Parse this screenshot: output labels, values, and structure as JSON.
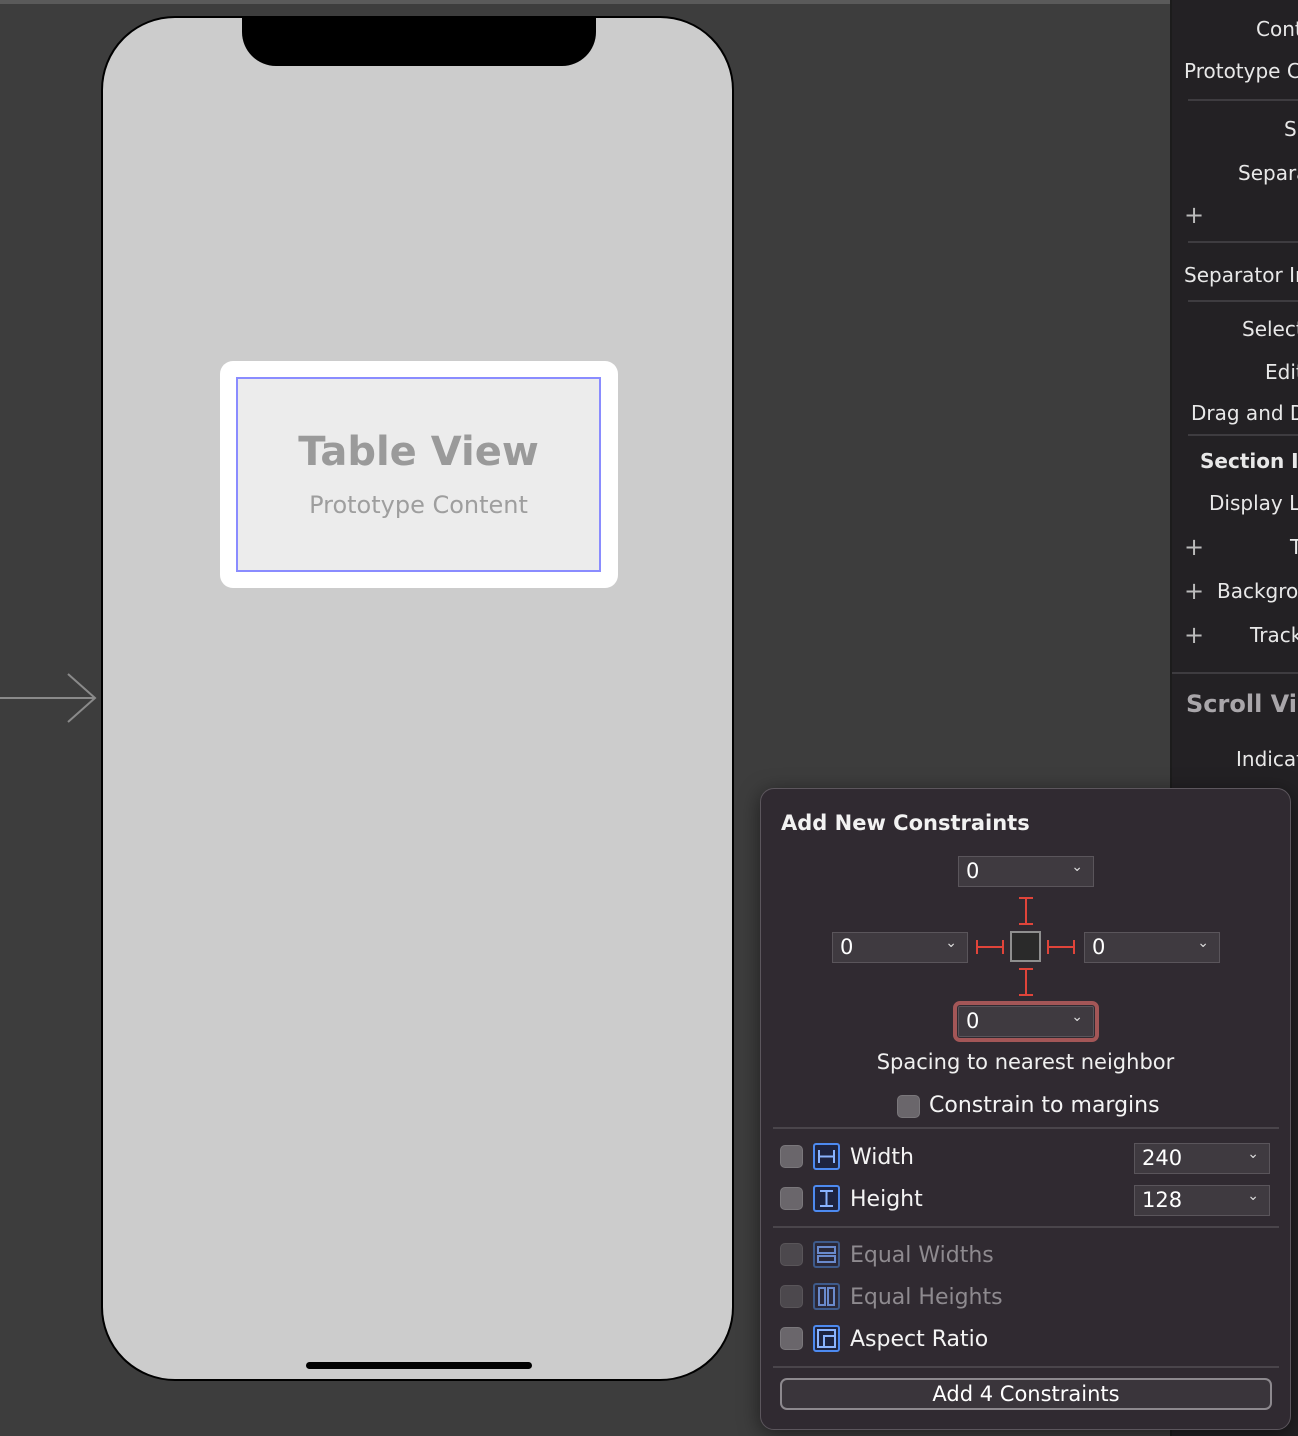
{
  "canvas": {
    "table_view": {
      "title": "Table View",
      "subtitle": "Prototype Content"
    }
  },
  "inspector": {
    "rows": [
      "Cont",
      "Prototype C",
      "S",
      "Separa",
      "Separator In",
      "Select",
      "Edit",
      "Drag and D",
      "Section In",
      "Display L",
      "T",
      "Backgro",
      "Track",
      "Scroll Vie",
      "Indicat"
    ]
  },
  "popover": {
    "title": "Add New Constraints",
    "spacing": {
      "top": "0",
      "left": "0",
      "right": "0",
      "bottom": "0"
    },
    "spacing_label": "Spacing to nearest neighbor",
    "constrain_to_margins": "Constrain to margins",
    "width": {
      "label": "Width",
      "value": "240"
    },
    "height": {
      "label": "Height",
      "value": "128"
    },
    "equal_widths": "Equal Widths",
    "equal_heights": "Equal Heights",
    "aspect_ratio": "Aspect Ratio",
    "add_button": "Add 4 Constraints"
  },
  "colors": {
    "strut_red": "#e0443a",
    "accent_blue": "#4d8af0",
    "focus_ring": "#a35657"
  }
}
